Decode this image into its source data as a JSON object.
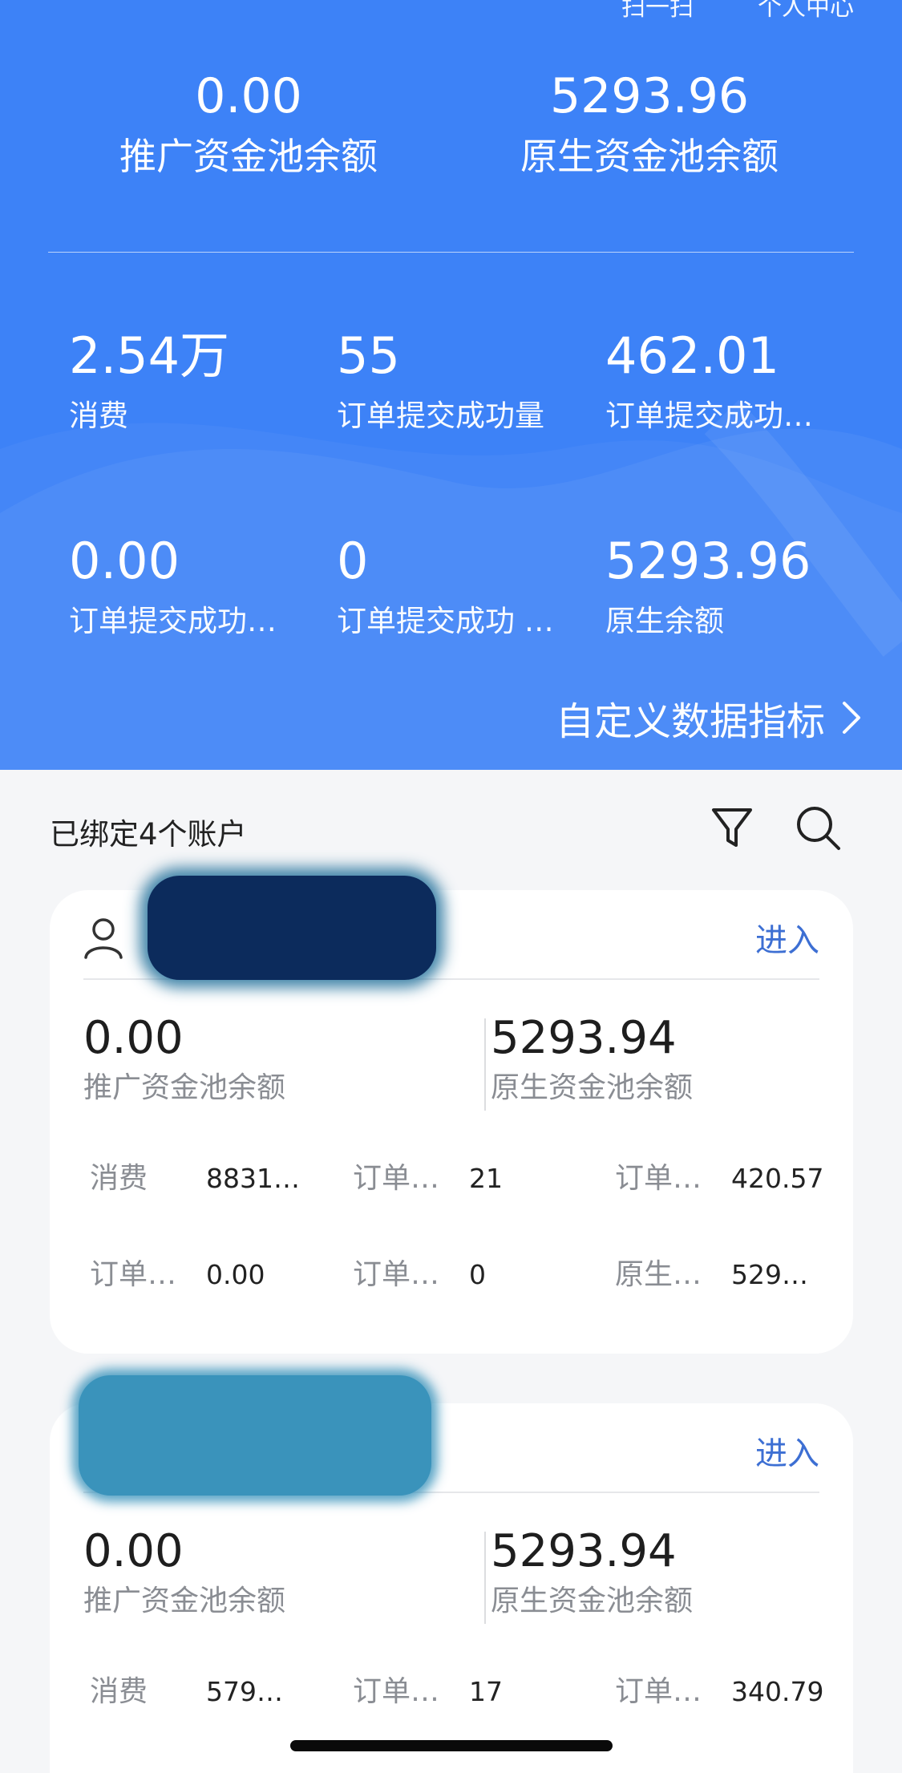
{
  "header": {
    "top_links": [
      "扫一扫",
      "个人中心"
    ],
    "promo_pool": {
      "value": "0.00",
      "label": "推广资金池余额"
    },
    "native_pool": {
      "value": "5293.96",
      "label": "原生资金池余额"
    },
    "stats": [
      {
        "value": "2.54万",
        "label": "消费"
      },
      {
        "value": "55",
        "label": "订单提交成功量"
      },
      {
        "value": "462.01",
        "label": "订单提交成功…"
      },
      {
        "value": "0.00",
        "label": "订单提交成功…"
      },
      {
        "value": "0",
        "label": "订单提交成功 …"
      },
      {
        "value": "5293.96",
        "label": "原生余额"
      }
    ],
    "custom_link": "自定义数据指标"
  },
  "accounts": {
    "title": "已绑定4个账户",
    "cards": [
      {
        "enter": "进入",
        "promo_pool": {
          "value": "0.00",
          "label": "推广资金池余额"
        },
        "native_pool": {
          "value": "5293.94",
          "label": "原生资金池余额"
        },
        "metrics": [
          {
            "k": "消费",
            "v": "8831…"
          },
          {
            "k": "订单…",
            "v": "21"
          },
          {
            "k": "订单…",
            "v": "420.57"
          },
          {
            "k": "订单…",
            "v": "0.00"
          },
          {
            "k": "订单…",
            "v": "0"
          },
          {
            "k": "原生…",
            "v": "529…"
          }
        ]
      },
      {
        "enter": "进入",
        "promo_pool": {
          "value": "0.00",
          "label": "推广资金池余额"
        },
        "native_pool": {
          "value": "5293.94",
          "label": "原生资金池余额"
        },
        "metrics": [
          {
            "k": "消费",
            "v": "579…"
          },
          {
            "k": "订单…",
            "v": "17"
          },
          {
            "k": "订单…",
            "v": "340.79"
          }
        ]
      }
    ]
  },
  "colors": {
    "primary": "#3d82f7",
    "link": "#3d6fd3",
    "background": "#f5f6f8"
  },
  "icons": [
    "filter-icon",
    "search-icon",
    "user-icon",
    "chevron-right-icon"
  ]
}
